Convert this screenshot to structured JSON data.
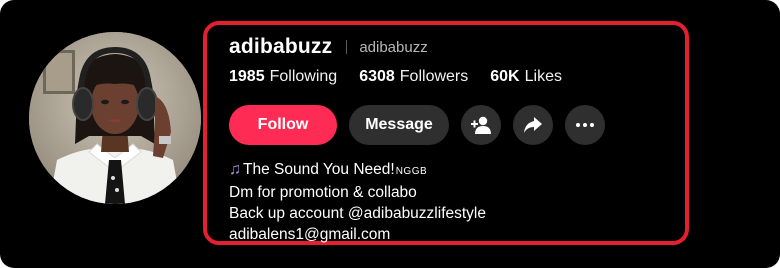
{
  "profile": {
    "username": "adibabuzz",
    "nickname": "adibabuzz",
    "stats": [
      {
        "value": "1985",
        "label": "Following"
      },
      {
        "value": "6308",
        "label": "Followers"
      },
      {
        "value": "60K",
        "label": "Likes"
      }
    ],
    "actions": {
      "follow_label": "Follow",
      "message_label": "Message",
      "icons": [
        "add-friend-icon",
        "share-icon",
        "more-icon"
      ]
    },
    "bio": {
      "line1_icon": "music-note-icon",
      "line1_text": "The Sound You Need!",
      "line1_suffix": "NGGB",
      "line2": "Dm for promotion & collabo",
      "line3": "Back up account @adibabuzzlifestyle",
      "line4": "adibalens1@gmail.com"
    }
  },
  "colors": {
    "background": "#000000",
    "accent": "#fe2c55",
    "button_secondary": "#2f2f2f",
    "highlight": "#e3202f"
  }
}
